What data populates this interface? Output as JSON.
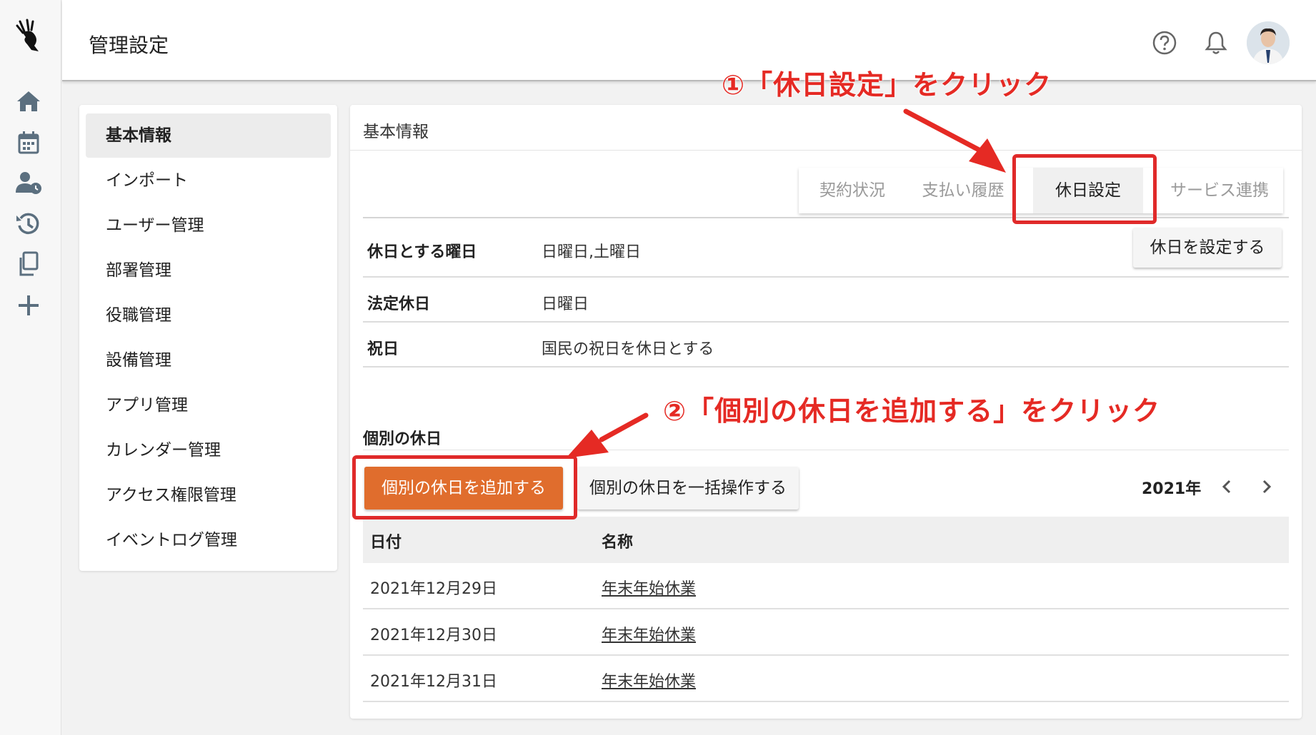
{
  "header": {
    "title": "管理設定"
  },
  "sidebar_rail": {
    "icons": [
      "logo-icon",
      "home-icon",
      "calendar-icon",
      "user-clock-icon",
      "history-icon",
      "copy-icon",
      "plus-icon"
    ]
  },
  "menu": {
    "items": [
      {
        "label": "基本情報",
        "active": true
      },
      {
        "label": "インポート"
      },
      {
        "label": "ユーザー管理"
      },
      {
        "label": "部署管理"
      },
      {
        "label": "役職管理"
      },
      {
        "label": "設備管理"
      },
      {
        "label": "アプリ管理"
      },
      {
        "label": "カレンダー管理"
      },
      {
        "label": "アクセス権限管理"
      },
      {
        "label": "イベントログ管理"
      }
    ]
  },
  "main": {
    "title": "基本情報",
    "tabs": [
      {
        "label": "契約状況"
      },
      {
        "label": "支払い履歴"
      },
      {
        "label": "休日設定",
        "active": true
      },
      {
        "label": "サービス連携"
      }
    ],
    "set_holiday_button": "休日を設定する",
    "settings": [
      {
        "label": "休日とする曜日",
        "value": "日曜日,土曜日"
      },
      {
        "label": "法定休日",
        "value": "日曜日"
      },
      {
        "label": "祝日",
        "value": "国民の祝日を休日とする"
      }
    ],
    "individual": {
      "title": "個別の休日",
      "add_button": "個別の休日を追加する",
      "bulk_button": "個別の休日を一括操作する",
      "year": "2021年",
      "columns": [
        "日付",
        "名称"
      ],
      "rows": [
        {
          "date": "2021年12月29日",
          "name": "年末年始休業"
        },
        {
          "date": "2021年12月30日",
          "name": "年末年始休業"
        },
        {
          "date": "2021年12月31日",
          "name": "年末年始休業"
        }
      ]
    }
  },
  "annotations": {
    "step1": "①「休日設定」をクリック",
    "step2": "②「個別の休日を追加する」をクリック",
    "color": "#e52a24"
  },
  "colors": {
    "primary_button": "#e06d2d"
  }
}
